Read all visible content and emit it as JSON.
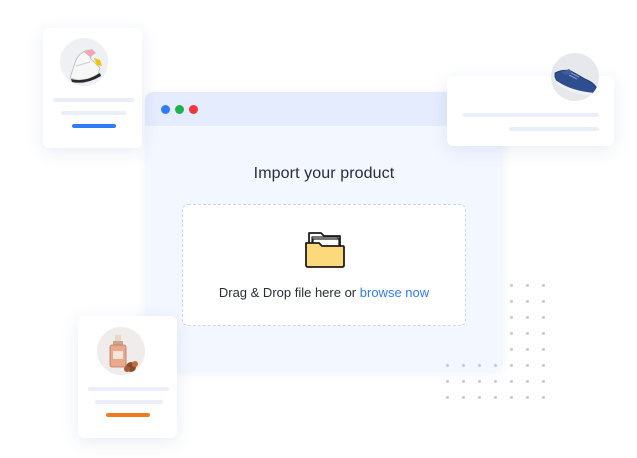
{
  "window": {
    "controls": [
      {
        "name": "blue",
        "color": "#2f7cf6"
      },
      {
        "name": "green",
        "color": "#22b14c"
      },
      {
        "name": "red",
        "color": "#f0353b"
      }
    ],
    "title": "Import your product",
    "dropzone": {
      "text": "Drag & Drop file here or",
      "link": "browse now",
      "icon": "folder-icon"
    }
  },
  "cards": {
    "sneaker": {
      "icon": "sneaker-image",
      "accent_color": "#2f7cf6"
    },
    "perfume": {
      "icon": "perfume-image",
      "accent_color": "#f07b1c"
    },
    "shoe": {
      "icon": "blue-shoe-image"
    }
  },
  "colors": {
    "window_bg": "#f3f7ff",
    "window_bar": "#e4ecfd",
    "link": "#2f7cf6",
    "folder": "#fcd97a"
  }
}
